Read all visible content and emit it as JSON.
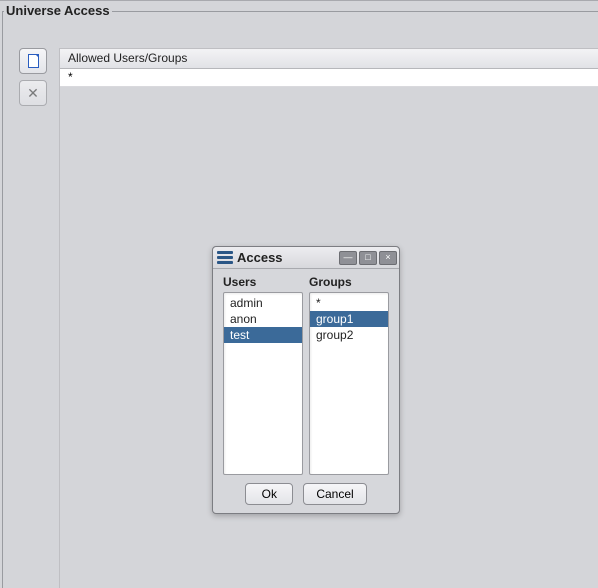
{
  "panel": {
    "title": "Universe Access"
  },
  "toolbar": {
    "new_icon": "document-icon",
    "delete_icon": "delete-icon"
  },
  "list": {
    "header": "Allowed Users/Groups",
    "rows": [
      "*"
    ]
  },
  "dialog": {
    "title": "Access",
    "winbtn_min": "—",
    "winbtn_max": "□",
    "winbtn_close": "×",
    "users_label": "Users",
    "groups_label": "Groups",
    "users": [
      {
        "label": "admin",
        "selected": false
      },
      {
        "label": "anon",
        "selected": false
      },
      {
        "label": "test",
        "selected": true
      }
    ],
    "groups": [
      {
        "label": "*",
        "selected": false
      },
      {
        "label": "group1",
        "selected": true
      },
      {
        "label": "group2",
        "selected": false
      }
    ],
    "ok_label": "Ok",
    "cancel_label": "Cancel"
  }
}
